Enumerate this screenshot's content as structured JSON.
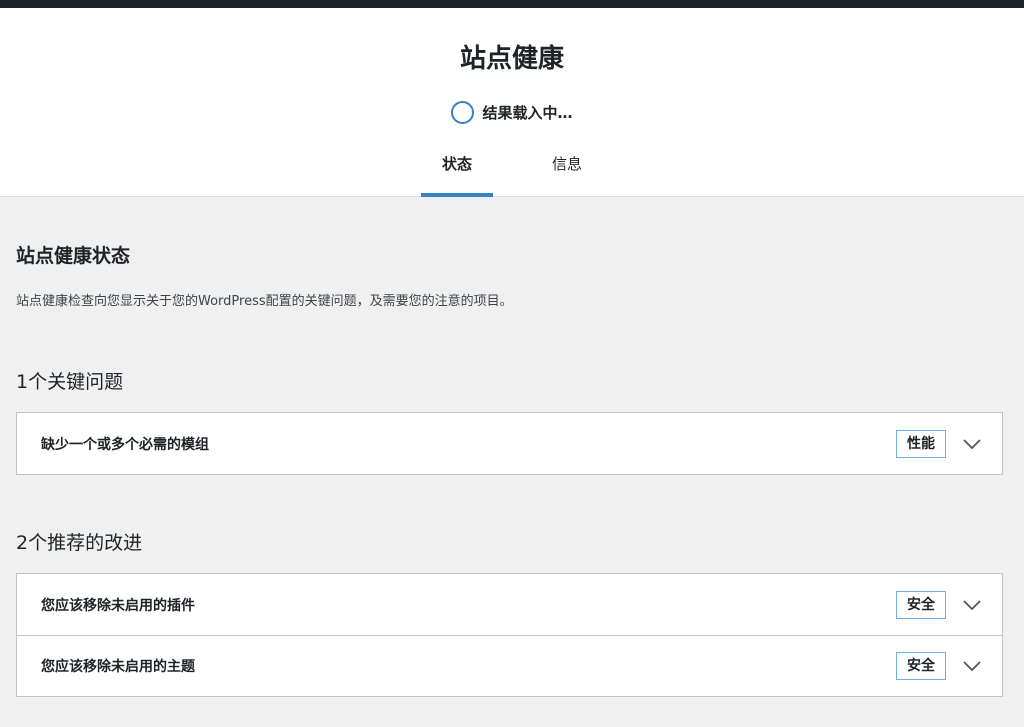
{
  "page": {
    "title": "站点健康",
    "progress_label": "结果载入中…"
  },
  "tabs": [
    {
      "label": "状态",
      "active": true
    },
    {
      "label": "信息",
      "active": false
    }
  ],
  "status": {
    "title": "站点健康状态",
    "description": "站点健康检查向您显示关于您的WordPress配置的关键问题，及需要您的注意的项目。"
  },
  "critical": {
    "heading": "1个关键问题",
    "items": [
      {
        "label": "缺少一个或多个必需的模组",
        "badge": "性能"
      }
    ]
  },
  "recommended": {
    "heading": "2个推荐的改进",
    "items": [
      {
        "label": "您应该移除未启用的插件",
        "badge": "安全"
      },
      {
        "label": "您应该移除未启用的主题",
        "badge": "安全"
      }
    ]
  },
  "colors": {
    "accent": "#3582c4",
    "badge_border": "#72aee6",
    "topbar": "#1d2327"
  },
  "icons": {
    "row_toggle": "chevron-down-icon",
    "progress": "progress-ring-icon"
  }
}
